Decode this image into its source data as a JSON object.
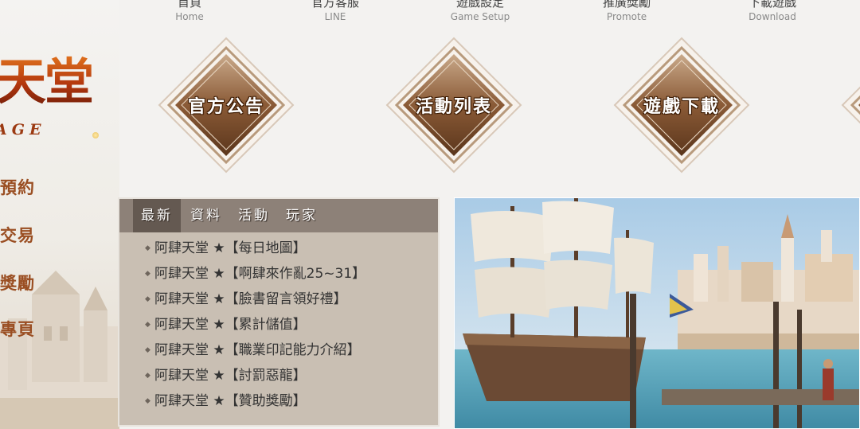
{
  "nav": [
    {
      "zh": "首頁",
      "en": "Home"
    },
    {
      "zh": "官方客服",
      "en": "LINE"
    },
    {
      "zh": "遊戲設定",
      "en": "Game Setup"
    },
    {
      "zh": "推廣獎勵",
      "en": "Promote"
    },
    {
      "zh": "下載遊戲",
      "en": "Download"
    }
  ],
  "logo": {
    "main": "天堂",
    "sub": "AGE"
  },
  "left_menu": [
    "預約",
    "交易",
    "獎勵",
    "專頁"
  ],
  "diamonds": [
    "官方公告",
    "活動列表",
    "遊戲下載"
  ],
  "news": {
    "tabs": [
      "最新",
      "資料",
      "活動",
      "玩家"
    ],
    "active_tab": 0,
    "items": [
      "阿肆天堂 ★【每日地圖】",
      "阿肆天堂 ★【啊肆來作亂25~31】",
      "阿肆天堂 ★【臉書留言領好禮】",
      "阿肆天堂 ★【累計儲值】",
      "阿肆天堂 ★【職業印記能力介紹】",
      "阿肆天堂 ★【討罰惡龍】",
      "阿肆天堂 ★【贊助獎勵】"
    ],
    "bullet": "◆"
  },
  "colors": {
    "accent": "#9a4e22",
    "tab_bar": "#8d8178",
    "tab_active": "#645951",
    "panel": "#c9bfb3"
  }
}
